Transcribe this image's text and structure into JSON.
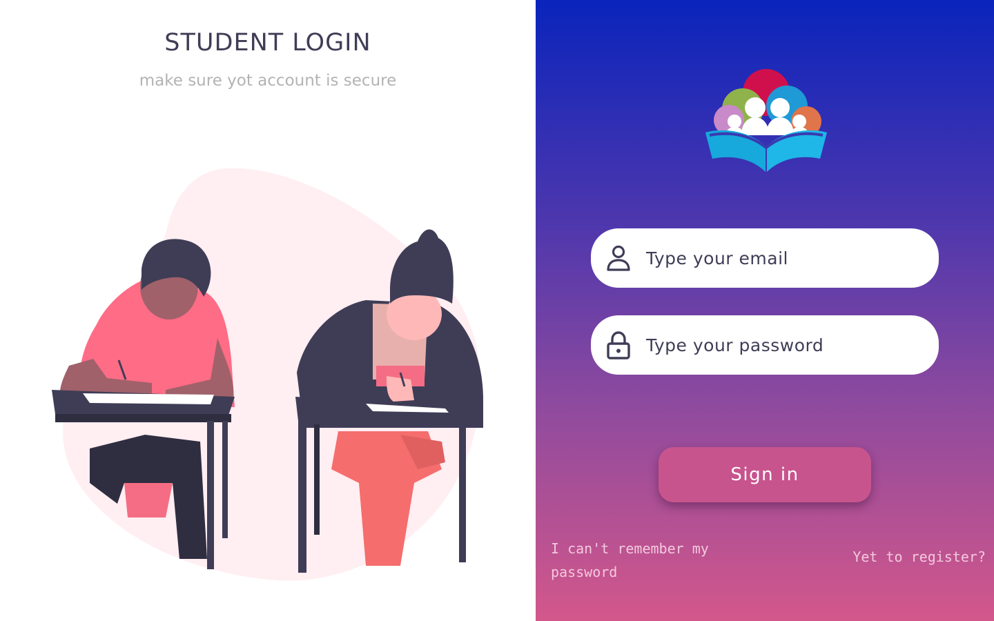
{
  "left": {
    "title": "STUDENT LOGIN",
    "subtitle": "make sure yot account is secure",
    "illustration_name": "students-taking-exam-illustration"
  },
  "right": {
    "logo_name": "school-logo",
    "email": {
      "placeholder": "Type your email",
      "value": "",
      "icon": "user-icon"
    },
    "password": {
      "placeholder": "Type your password",
      "value": "",
      "icon": "lock-icon"
    },
    "signin_label": "Sign in",
    "forgot_label": "I can't remember my password",
    "register_label": "Yet to register?"
  },
  "colors": {
    "gradient_top": "#0a24bc",
    "gradient_bottom": "#d3578b",
    "button": "#c8548e",
    "link": "#f3c9dd",
    "title": "#3f3d56",
    "subtitle": "#b3b3b3"
  }
}
